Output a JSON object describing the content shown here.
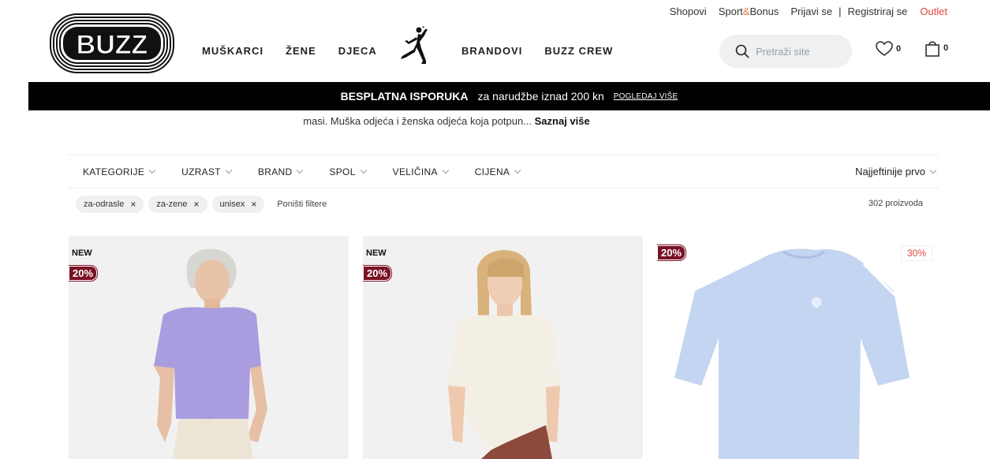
{
  "toplinks": {
    "shops": "Shopovi",
    "sport": "Sport",
    "amp": "&",
    "bonus": "Bonus",
    "login": "Prijavi se",
    "separator": "|",
    "register": "Registriraj se",
    "outlet": "Outlet"
  },
  "logo": {
    "text": "BUZZ"
  },
  "nav": {
    "items": [
      "MUŠKARCI",
      "ŽENE",
      "DJECA"
    ],
    "items2": [
      "BRANDOVI",
      "BUZZ CREW"
    ]
  },
  "search": {
    "placeholder": "Pretraži site"
  },
  "wishlist": {
    "count": "0"
  },
  "cart": {
    "count": "0"
  },
  "promo": {
    "bold": "BESPLATNA ISPORUKA",
    "text": "za narudžbe iznad 200 kn",
    "link": "POGLEDAJ VIŠE"
  },
  "intro": {
    "text": "masi. Muška odjeća i ženska odjeća koja potpun...",
    "more": "Saznaj više"
  },
  "filters": {
    "items": [
      "KATEGORIJE",
      "UZRAST",
      "BRAND",
      "SPOL",
      "VELIČINA",
      "CIJENA"
    ],
    "sort": "Najjeftinije prvo"
  },
  "chips": {
    "items": [
      "za-odrasle",
      "za-zene",
      "unisex"
    ],
    "reset": "Poništi filtere",
    "count": "302 proizvoda"
  },
  "products": [
    {
      "new": "NEW",
      "discount": "20%"
    },
    {
      "new": "NEW",
      "discount": "20%"
    },
    {
      "discount": "20%",
      "percent": "30%"
    }
  ],
  "colors": {
    "promo_bg": "#000000",
    "discount_badge": "#7a1224",
    "outlet": "#e0463a",
    "accent": "#e07a43"
  }
}
